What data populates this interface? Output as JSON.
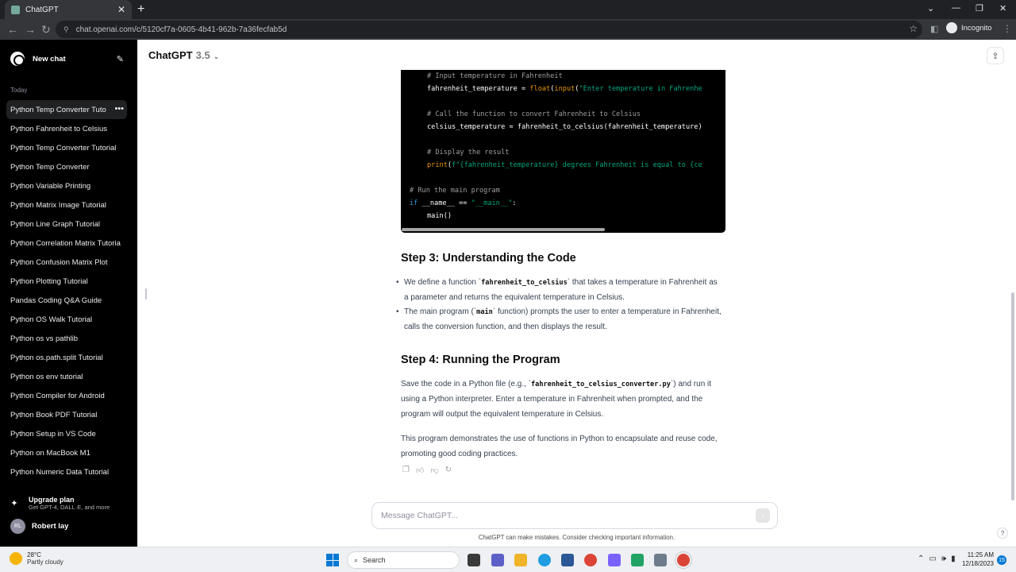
{
  "browser": {
    "tab_title": "ChatGPT",
    "url": "chat.openai.com/c/5120cf7a-0605-4b41-962b-7a36fecfab5d",
    "incognito_label": "Incognito"
  },
  "sidebar": {
    "new_chat": "New chat",
    "section_label": "Today",
    "items": [
      {
        "label": "Python Temp Converter Tuto",
        "active": true
      },
      {
        "label": "Python Fahrenheit to Celsius"
      },
      {
        "label": "Python Temp Converter Tutorial"
      },
      {
        "label": "Python Temp Converter"
      },
      {
        "label": "Python Variable Printing"
      },
      {
        "label": "Python Matrix Image Tutorial"
      },
      {
        "label": "Python Line Graph Tutorial"
      },
      {
        "label": "Python Correlation Matrix Tutoria"
      },
      {
        "label": "Python Confusion Matrix Plot"
      },
      {
        "label": "Python Plotting Tutorial"
      },
      {
        "label": "Pandas Coding Q&A Guide"
      },
      {
        "label": "Python OS Walk Tutorial"
      },
      {
        "label": "Python os vs pathlib"
      },
      {
        "label": "Python os.path.split Tutorial"
      },
      {
        "label": "Python os env tutorial"
      },
      {
        "label": "Python Compiler for Android"
      },
      {
        "label": "Python Book PDF Tutorial"
      },
      {
        "label": "Python Setup in VS Code"
      },
      {
        "label": "Python on MacBook M1"
      },
      {
        "label": "Python Numeric Data Tutorial"
      }
    ],
    "upgrade_title": "Upgrade plan",
    "upgrade_sub": "Get GPT-4, DALL·E, and more",
    "user_initials": "RL",
    "user_name": "Robert lay"
  },
  "header": {
    "model_name": "ChatGPT",
    "model_version": "3.5"
  },
  "code_lines": [
    {
      "indent": 4,
      "parts": [
        {
          "c": "com",
          "t": "# Input temperature in Fahrenheit"
        }
      ]
    },
    {
      "indent": 4,
      "parts": [
        {
          "c": "",
          "t": "fahrenheit_temperature = "
        },
        {
          "c": "fn",
          "t": "float"
        },
        {
          "c": "",
          "t": "("
        },
        {
          "c": "fn",
          "t": "input"
        },
        {
          "c": "",
          "t": "("
        },
        {
          "c": "str",
          "t": "\"Enter temperature in Fahrenhe"
        }
      ]
    },
    {
      "indent": 0,
      "parts": []
    },
    {
      "indent": 4,
      "parts": [
        {
          "c": "com",
          "t": "# Call the function to convert Fahrenheit to Celsius"
        }
      ]
    },
    {
      "indent": 4,
      "parts": [
        {
          "c": "",
          "t": "celsius_temperature = fahrenheit_to_celsius(fahrenheit_temperature)"
        }
      ]
    },
    {
      "indent": 0,
      "parts": []
    },
    {
      "indent": 4,
      "parts": [
        {
          "c": "com",
          "t": "# Display the result"
        }
      ]
    },
    {
      "indent": 4,
      "parts": [
        {
          "c": "fn",
          "t": "print"
        },
        {
          "c": "",
          "t": "("
        },
        {
          "c": "str",
          "t": "f\"{fahrenheit_temperature} degrees Fahrenheit is equal to {ce"
        }
      ]
    },
    {
      "indent": 0,
      "parts": []
    },
    {
      "indent": 0,
      "parts": [
        {
          "c": "com",
          "t": "# Run the main program"
        }
      ]
    },
    {
      "indent": 0,
      "parts": [
        {
          "c": "kw",
          "t": "if"
        },
        {
          "c": "",
          "t": " __name__ == "
        },
        {
          "c": "str",
          "t": "\"__main__\""
        },
        {
          "c": "",
          "t": ":"
        }
      ]
    },
    {
      "indent": 4,
      "parts": [
        {
          "c": "",
          "t": "main()"
        }
      ]
    }
  ],
  "content": {
    "step3_heading": "Step 3: Understanding the Code",
    "bullet1_a": "We define a function `",
    "bullet1_code": "fahrenheit_to_celsius",
    "bullet1_b": "` that takes a temperature in Fahrenheit as a parameter and returns the equivalent temperature in Celsius.",
    "bullet2_a": "The main program (`",
    "bullet2_code": "main",
    "bullet2_b": "` function) prompts the user to enter a temperature in Fahrenheit, calls the conversion function, and then displays the result.",
    "step4_heading": "Step 4: Running the Program",
    "para1_a": "Save the code in a Python file (e.g., `",
    "para1_code": "fahrenheit_to_celsius_converter.py",
    "para1_b": "`) and run it using a Python interpreter. Enter a temperature in Fahrenheit when prompted, and the program will output the equivalent temperature in Celsius.",
    "para2": "This program demonstrates the use of functions in Python to encapsulate and reuse code, promoting good coding practices."
  },
  "composer": {
    "placeholder": "Message ChatGPT...",
    "disclaimer": "ChatGPT can make mistakes. Consider checking important information."
  },
  "taskbar": {
    "temperature": "28°C",
    "weather": "Partly cloudy",
    "search_label": "Search",
    "time": "11:25 AM",
    "date": "12/18/2023",
    "notifications": "15"
  }
}
